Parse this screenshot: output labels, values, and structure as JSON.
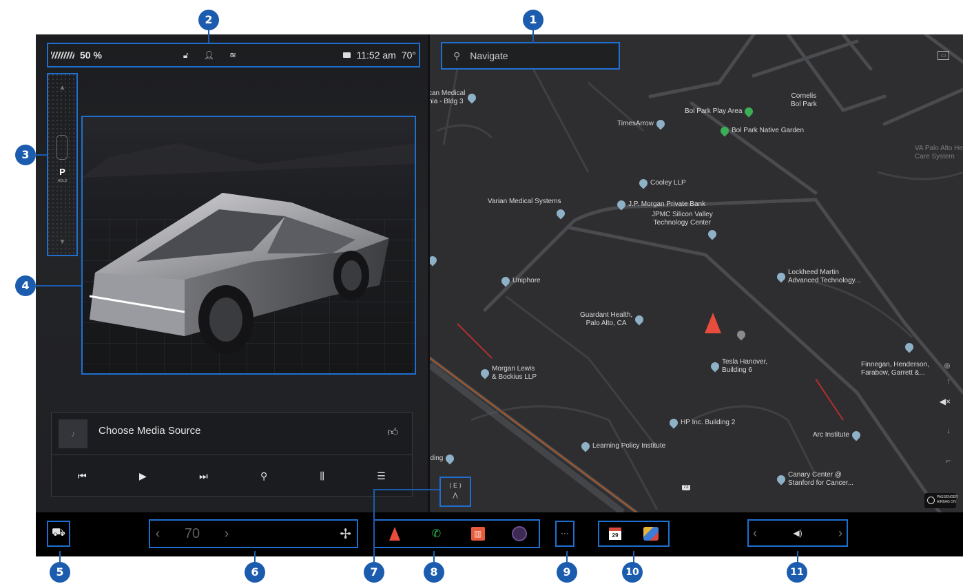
{
  "status_bar": {
    "battery_percent": "50 %",
    "time": "11:52 am",
    "temperature": "70°"
  },
  "gear": {
    "selected": "P",
    "hold": "HOLD"
  },
  "media": {
    "title": "Choose Media Source",
    "art_glyph": "♪"
  },
  "map": {
    "search_placeholder": "Navigate",
    "pois": [
      {
        "label": "can Medical\nnia - Bldg 3"
      },
      {
        "label": "Bol Park Play Area"
      },
      {
        "label": "Cornelis\nBol Park"
      },
      {
        "label": "TimesArrow"
      },
      {
        "label": "Bol Park Native Garden"
      },
      {
        "label": "VA Palo Alto He\nCare System"
      },
      {
        "label": "Cooley LLP"
      },
      {
        "label": "Varian Medical Systems"
      },
      {
        "label": "J.P. Morgan Private Bank"
      },
      {
        "label": "JPMC Silicon Valley\nTechnology Center"
      },
      {
        "label": "Uniphore"
      },
      {
        "label": "Lockheed Martin\nAdvanced Technology..."
      },
      {
        "label": "Guardant Health,\nPalo Alto, CA"
      },
      {
        "label": "Tesla Hanover,\nBuilding 6"
      },
      {
        "label": "Morgan Lewis\n& Bockius LLP"
      },
      {
        "label": "Finnegan, Henderson,\nFarabow, Garrett &..."
      },
      {
        "label": "HP Inc. Building 2"
      },
      {
        "label": "Learning Policy Institute"
      },
      {
        "label": "Arc Institute"
      },
      {
        "label": "Canary Center @\nStanford for Cancer..."
      },
      {
        "label": "ilding"
      }
    ],
    "road_shield": "72",
    "airbag": "PASSENGER\nAIRBAG ON"
  },
  "bottom_bar": {
    "temperature": "70",
    "calendar_day": "29",
    "more_label": "···"
  },
  "callouts": [
    "1",
    "2",
    "3",
    "4",
    "5",
    "6",
    "7",
    "8",
    "9",
    "10",
    "11"
  ],
  "colors": {
    "callout_blue": "#1b5cae",
    "highlight_blue": "#1f6fd1",
    "nav_arrow": "#e74c3c"
  }
}
